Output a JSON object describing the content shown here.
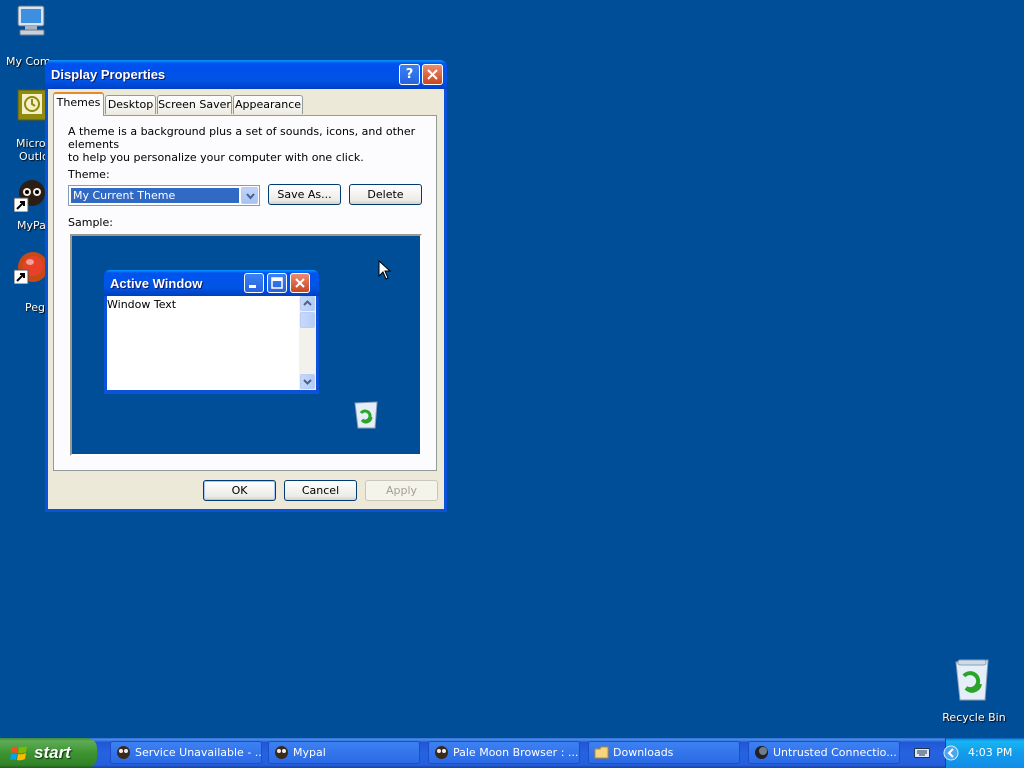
{
  "desktop": {
    "icons": [
      {
        "label": "My Computer",
        "icon": "my-computer-icon"
      },
      {
        "label": "Microsoft Outlook",
        "icon": "outlook-icon"
      },
      {
        "label": "MyPal",
        "icon": "mypal-icon"
      },
      {
        "label": "Pegasus",
        "icon": "pegasus-icon"
      },
      {
        "label": "Recycle Bin",
        "icon": "recycle-bin-icon"
      }
    ],
    "visible_labels": {
      "my_computer": "My Com",
      "outlook_line1": "Micros",
      "outlook_line2": "Outlo",
      "mypal": "MyPa",
      "pegasus": "Peg",
      "recycle_bin": "Recycle Bin"
    }
  },
  "window": {
    "title": "Display Properties",
    "help_label": "?",
    "close_label": "✕",
    "tabs": [
      {
        "label": "Themes",
        "active": true
      },
      {
        "label": "Desktop",
        "active": false
      },
      {
        "label": "Screen Saver",
        "active": false
      },
      {
        "label": "Appearance",
        "active": false
      }
    ],
    "description_line1": "A theme is a background plus a set of sounds, icons, and other elements",
    "description_line2": "to help you personalize your computer with one click.",
    "theme_label": "Theme:",
    "theme_value": "My Current Theme",
    "save_as_label": "Save As...",
    "delete_label": "Delete",
    "sample_label": "Sample:",
    "sample": {
      "title": "Active Window",
      "text": "Window Text"
    },
    "ok_label": "OK",
    "cancel_label": "Cancel",
    "apply_label": "Apply"
  },
  "taskbar": {
    "start_label": "start",
    "tasks": [
      {
        "label": "Service Unavailable - ...",
        "icon": "browser-icon"
      },
      {
        "label": "Mypal",
        "icon": "mypal-icon"
      },
      {
        "label": "Pale Moon Browser : ...",
        "icon": "browser-icon"
      },
      {
        "label": "Downloads",
        "icon": "folder-icon"
      },
      {
        "label": "Untrusted Connectio...",
        "icon": "pale-moon-icon"
      }
    ],
    "clock": "4:03 PM"
  },
  "colors": {
    "desktop": "#004e98",
    "titlebar": "#0054e3",
    "start": "#3d9431",
    "selection": "#316ac5"
  }
}
